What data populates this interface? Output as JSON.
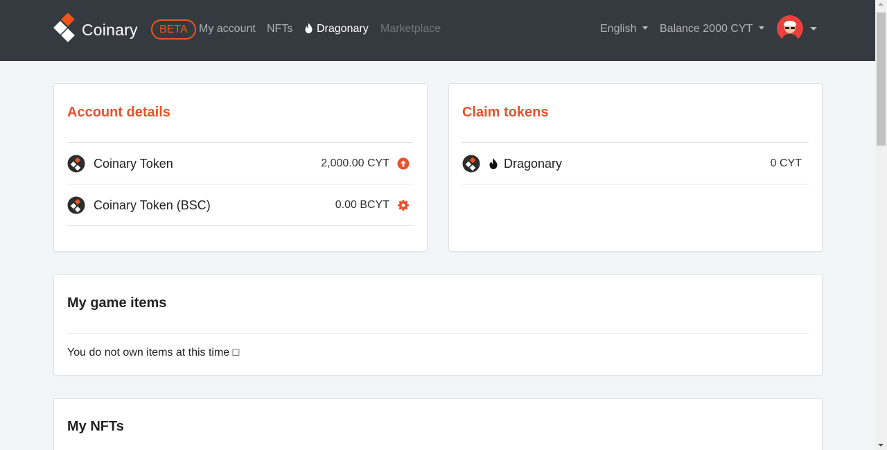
{
  "header": {
    "brand_name": "Coinary",
    "beta_badge": "BETA",
    "nav": {
      "my_account": "My account",
      "nfts": "NFTs",
      "dragonary": "Dragonary",
      "marketplace": "Marketplace"
    },
    "language": "English",
    "balance": "Balance 2000 CYT"
  },
  "account_details": {
    "title": "Account details",
    "rows": [
      {
        "label": "Coinary Token",
        "value": "2,000.00 CYT",
        "action_icon": "arrow-up-circle-icon"
      },
      {
        "label": "Coinary Token (BSC)",
        "value": "0.00 BCYT",
        "action_icon": "gear-icon"
      }
    ]
  },
  "claim_tokens": {
    "title": "Claim tokens",
    "rows": [
      {
        "label": "Dragonary",
        "value": "0 CYT"
      }
    ]
  },
  "game_items": {
    "title": "My game items",
    "empty_message": "You do not own items at this time □"
  },
  "nfts": {
    "title": "My NFTs"
  },
  "colors": {
    "accent": "#e6522c",
    "header_bg": "#343a40",
    "page_bg": "#f4f5f8"
  }
}
